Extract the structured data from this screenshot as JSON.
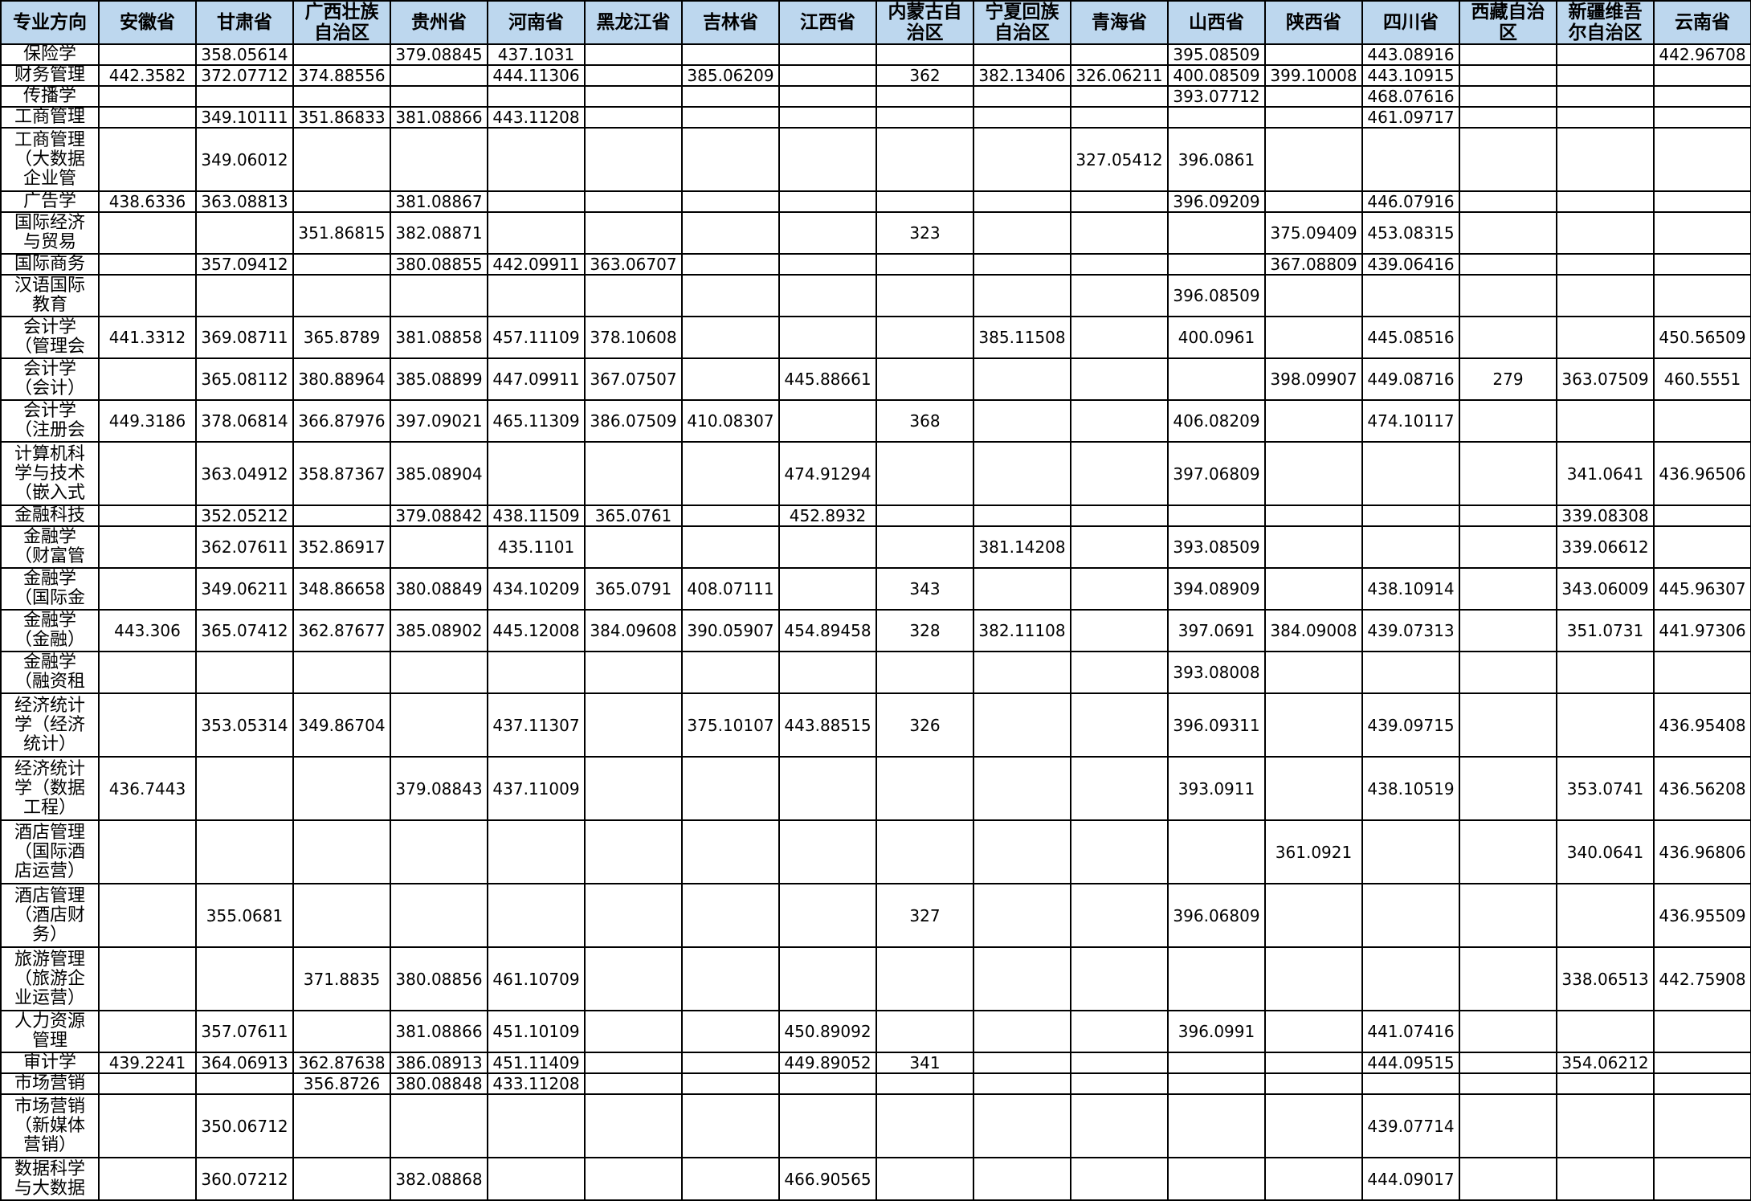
{
  "table": {
    "headers": [
      "专业方向",
      "安徽省",
      "甘肃省",
      "广西壮族\n自治区",
      "贵州省",
      "河南省",
      "黑龙江省",
      "吉林省",
      "江西省",
      "内蒙古自\n治区",
      "宁夏回族\n自治区",
      "青海省",
      "山西省",
      "陕西省",
      "四川省",
      "西藏自治\n区",
      "新疆维吾\n尔自治区",
      "云南省"
    ],
    "rows": [
      [
        "保险学",
        "",
        "358.05614",
        "",
        "379.08845",
        "437.1031",
        "",
        "",
        "",
        "",
        "",
        "",
        "395.08509",
        "",
        "443.08916",
        "",
        "",
        "442.96708"
      ],
      [
        "财务管理",
        "442.3582",
        "372.07712",
        "374.88556",
        "",
        "444.11306",
        "",
        "385.06209",
        "",
        "362",
        "382.13406",
        "326.06211",
        "400.08509",
        "399.10008",
        "443.10915",
        "",
        "",
        ""
      ],
      [
        "传播学",
        "",
        "",
        "",
        "",
        "",
        "",
        "",
        "",
        "",
        "",
        "",
        "393.07712",
        "",
        "468.07616",
        "",
        "",
        ""
      ],
      [
        "工商管理",
        "",
        "349.10111",
        "351.86833",
        "381.08866",
        "443.11208",
        "",
        "",
        "",
        "",
        "",
        "",
        "",
        "",
        "461.09717",
        "",
        "",
        ""
      ],
      [
        "工商管理\n（大数据\n企业管",
        "",
        "349.06012",
        "",
        "",
        "",
        "",
        "",
        "",
        "",
        "",
        "327.05412",
        "396.0861",
        "",
        "",
        "",
        "",
        ""
      ],
      [
        "广告学",
        "438.6336",
        "363.08813",
        "",
        "381.08867",
        "",
        "",
        "",
        "",
        "",
        "",
        "",
        "396.09209",
        "",
        "446.07916",
        "",
        "",
        ""
      ],
      [
        "国际经济\n与贸易",
        "",
        "",
        "351.86815",
        "382.08871",
        "",
        "",
        "",
        "",
        "323",
        "",
        "",
        "",
        "375.09409",
        "453.08315",
        "",
        "",
        ""
      ],
      [
        "国际商务",
        "",
        "357.09412",
        "",
        "380.08855",
        "442.09911",
        "363.06707",
        "",
        "",
        "",
        "",
        "",
        "",
        "367.08809",
        "439.06416",
        "",
        "",
        ""
      ],
      [
        "汉语国际\n教育",
        "",
        "",
        "",
        "",
        "",
        "",
        "",
        "",
        "",
        "",
        "",
        "396.08509",
        "",
        "",
        "",
        "",
        ""
      ],
      [
        "会计学\n（管理会",
        "441.3312",
        "369.08711",
        "365.8789",
        "381.08858",
        "457.11109",
        "378.10608",
        "",
        "",
        "",
        "385.11508",
        "",
        "400.0961",
        "",
        "445.08516",
        "",
        "",
        "450.56509"
      ],
      [
        "会计学\n（会计）",
        "",
        "365.08112",
        "380.88964",
        "385.08899",
        "447.09911",
        "367.07507",
        "",
        "445.88661",
        "",
        "",
        "",
        "",
        "398.09907",
        "449.08716",
        "279",
        "363.07509",
        "460.5551"
      ],
      [
        "会计学\n（注册会",
        "449.3186",
        "378.06814",
        "366.87976",
        "397.09021",
        "465.11309",
        "386.07509",
        "410.08307",
        "",
        "368",
        "",
        "",
        "406.08209",
        "",
        "474.10117",
        "",
        "",
        ""
      ],
      [
        "计算机科\n学与技术\n（嵌入式",
        "",
        "363.04912",
        "358.87367",
        "385.08904",
        "",
        "",
        "",
        "474.91294",
        "",
        "",
        "",
        "397.06809",
        "",
        "",
        "",
        "341.0641",
        "436.96506"
      ],
      [
        "金融科技",
        "",
        "352.05212",
        "",
        "379.08842",
        "438.11509",
        "365.0761",
        "",
        "452.8932",
        "",
        "",
        "",
        "",
        "",
        "",
        "",
        "339.08308",
        ""
      ],
      [
        "金融学\n（财富管",
        "",
        "362.07611",
        "352.86917",
        "",
        "435.1101",
        "",
        "",
        "",
        "",
        "381.14208",
        "",
        "393.08509",
        "",
        "",
        "",
        "339.06612",
        ""
      ],
      [
        "金融学\n（国际金",
        "",
        "349.06211",
        "348.86658",
        "380.08849",
        "434.10209",
        "365.0791",
        "408.07111",
        "",
        "343",
        "",
        "",
        "394.08909",
        "",
        "438.10914",
        "",
        "343.06009",
        "445.96307"
      ],
      [
        "金融学\n（金融）",
        "443.306",
        "365.07412",
        "362.87677",
        "385.08902",
        "445.12008",
        "384.09608",
        "390.05907",
        "454.89458",
        "328",
        "382.11108",
        "",
        "397.0691",
        "384.09008",
        "439.07313",
        "",
        "351.0731",
        "441.97306"
      ],
      [
        "金融学\n（融资租",
        "",
        "",
        "",
        "",
        "",
        "",
        "",
        "",
        "",
        "",
        "",
        "393.08008",
        "",
        "",
        "",
        "",
        ""
      ],
      [
        "经济统计\n学（经济\n统计）",
        "",
        "353.05314",
        "349.86704",
        "",
        "437.11307",
        "",
        "375.10107",
        "443.88515",
        "326",
        "",
        "",
        "396.09311",
        "",
        "439.09715",
        "",
        "",
        "436.95408"
      ],
      [
        "经济统计\n学（数据\n工程）",
        "436.7443",
        "",
        "",
        "379.08843",
        "437.11009",
        "",
        "",
        "",
        "",
        "",
        "",
        "393.0911",
        "",
        "438.10519",
        "",
        "353.0741",
        "436.56208"
      ],
      [
        "酒店管理\n（国际酒\n店运营）",
        "",
        "",
        "",
        "",
        "",
        "",
        "",
        "",
        "",
        "",
        "",
        "",
        "361.0921",
        "",
        "",
        "340.0641",
        "436.96806"
      ],
      [
        "酒店管理\n（酒店财\n务）",
        "",
        "355.0681",
        "",
        "",
        "",
        "",
        "",
        "",
        "327",
        "",
        "",
        "396.06809",
        "",
        "",
        "",
        "",
        "436.95509"
      ],
      [
        "旅游管理\n（旅游企\n业运营）",
        "",
        "",
        "371.8835",
        "380.08856",
        "461.10709",
        "",
        "",
        "",
        "",
        "",
        "",
        "",
        "",
        "",
        "",
        "338.06513",
        "442.75908"
      ],
      [
        "人力资源\n管理",
        "",
        "357.07611",
        "",
        "381.08866",
        "451.10109",
        "",
        "",
        "450.89092",
        "",
        "",
        "",
        "396.0991",
        "",
        "441.07416",
        "",
        "",
        ""
      ],
      [
        "审计学",
        "439.2241",
        "364.06913",
        "362.87638",
        "386.08913",
        "451.11409",
        "",
        "",
        "449.89052",
        "341",
        "",
        "",
        "",
        "",
        "444.09515",
        "",
        "354.06212",
        ""
      ],
      [
        "市场营销",
        "",
        "",
        "356.8726",
        "380.08848",
        "433.11208",
        "",
        "",
        "",
        "",
        "",
        "",
        "",
        "",
        "",
        "",
        "",
        ""
      ],
      [
        "市场营销\n（新媒体\n营销）",
        "",
        "350.06712",
        "",
        "",
        "",
        "",
        "",
        "",
        "",
        "",
        "",
        "",
        "",
        "439.07714",
        "",
        "",
        ""
      ],
      [
        "数据科学\n与大数据",
        "",
        "360.07212",
        "",
        "382.08868",
        "",
        "",
        "",
        "466.90565",
        "",
        "",
        "",
        "",
        "",
        "444.09017",
        "",
        "",
        ""
      ]
    ]
  },
  "colors": {
    "header_bg": "#bdd7ee",
    "border": "#000000"
  }
}
